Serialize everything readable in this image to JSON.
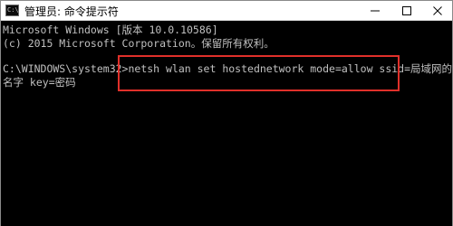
{
  "window": {
    "title": "管理员: 命令提示符",
    "icon": "cmd-icon",
    "icon_text": "C:\\",
    "controls": [
      "minimize-icon",
      "maximize-icon",
      "close-icon"
    ]
  },
  "console": {
    "lines": [
      "Microsoft Windows [版本 10.0.10586]",
      "(c) 2015 Microsoft Corporation。保留所有权利。",
      "C:\\WINDOWS\\system32>netsh wlan set hostednetwork mode=allow ssid=局域网的",
      "名字 key=密码"
    ]
  },
  "colors": {
    "console_bg": "#000000",
    "console_text": "#c0c0c0",
    "highlight": "#e0302a"
  }
}
